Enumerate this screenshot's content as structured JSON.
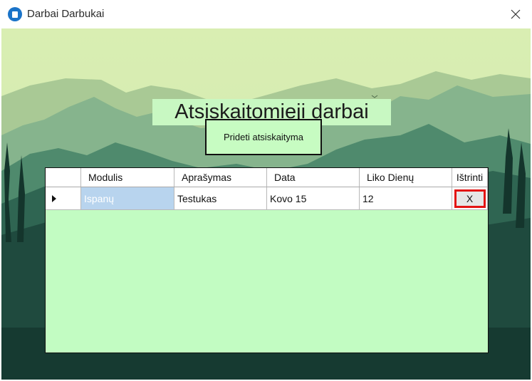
{
  "window": {
    "title": "Darbai Darbukai"
  },
  "main": {
    "heading": "Atsiskaitomieji darbai",
    "add_button_label": "Prideti atsiskaityma"
  },
  "grid": {
    "columns": [
      "Modulis",
      "Aprašymas",
      "Data",
      "Liko Dienų",
      "Ištrinti"
    ],
    "rows": [
      {
        "modulis": "Ispanų",
        "aprasymas": "Testukas",
        "data": "Kovo 15",
        "liko_dienu": "12",
        "delete_label": "X"
      }
    ]
  },
  "colors": {
    "grid_background": "#c2fcc2",
    "delete_border": "#e31414",
    "selected_cell": "#b8d4ee"
  }
}
